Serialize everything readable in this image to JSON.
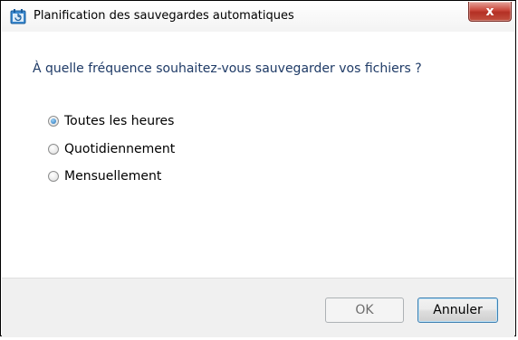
{
  "window": {
    "title": "Planification des sauvegardes automatiques",
    "close_label": "x"
  },
  "dialog": {
    "question": "À quelle fréquence souhaitez-vous sauvegarder vos fichiers ?",
    "options": [
      {
        "label": "Toutes les heures",
        "checked": true
      },
      {
        "label": "Quotidiennement",
        "checked": false
      },
      {
        "label": "Mensuellement",
        "checked": false
      }
    ]
  },
  "footer": {
    "ok_label": "OK",
    "cancel_label": "Annuler"
  },
  "colors": {
    "accent": "#1f6fb8",
    "question_text": "#1e3a66",
    "footer_bg": "#f0f0f0",
    "close_red": "#c9473a"
  }
}
